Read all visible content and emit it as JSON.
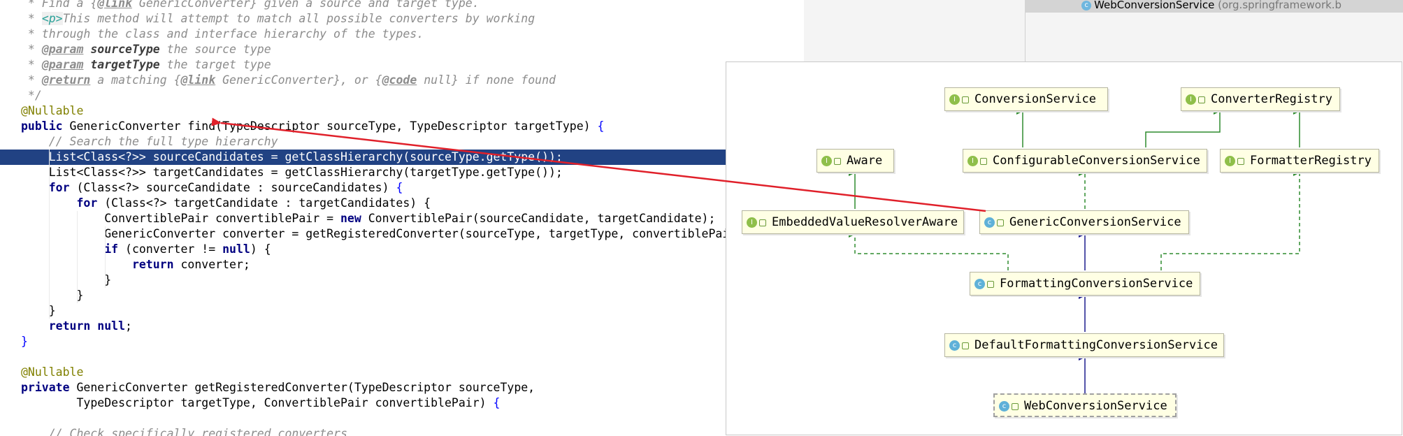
{
  "editor": {
    "lines": [
      [
        {
          "t": "cm",
          "v": " * Find a {"
        },
        {
          "t": "tag-b",
          "v": "@link"
        },
        {
          "t": "cm",
          "v": " GenericConverter} given a source and target type."
        }
      ],
      [
        {
          "t": "cm",
          "v": " * "
        },
        {
          "t": "tag-h",
          "v": "<p>"
        },
        {
          "t": "cm",
          "v": "This method will attempt to match all possible converters by working"
        }
      ],
      [
        {
          "t": "cm",
          "v": " * through the class and interface hierarchy of the types."
        }
      ],
      [
        {
          "t": "cm",
          "v": " * "
        },
        {
          "t": "tag-b",
          "v": "@param"
        },
        {
          "t": "cm",
          "v": " "
        },
        {
          "t": "pm",
          "v": "sourceType"
        },
        {
          "t": "cm",
          "v": " the source type"
        }
      ],
      [
        {
          "t": "cm",
          "v": " * "
        },
        {
          "t": "tag-b",
          "v": "@param"
        },
        {
          "t": "cm",
          "v": " "
        },
        {
          "t": "pm",
          "v": "targetType"
        },
        {
          "t": "cm",
          "v": " the target type"
        }
      ],
      [
        {
          "t": "cm",
          "v": " * "
        },
        {
          "t": "tag-b",
          "v": "@return"
        },
        {
          "t": "cm",
          "v": " a matching {"
        },
        {
          "t": "tag-b",
          "v": "@link"
        },
        {
          "t": "cm",
          "v": " GenericConverter}, or {"
        },
        {
          "t": "tag-b",
          "v": "@code"
        },
        {
          "t": "cm",
          "v": " null} if none found"
        }
      ],
      [
        {
          "t": "cm",
          "v": " */"
        }
      ],
      [
        {
          "t": "an",
          "v": "@Nullable"
        }
      ],
      [
        {
          "t": "kw",
          "v": "public"
        },
        {
          "t": "",
          "v": " GenericConverter find(TypeDescriptor sourceType, TypeDescriptor targetType) "
        },
        {
          "t": "br",
          "v": "{"
        }
      ],
      [
        {
          "t": "cm",
          "v": "    // Search the full type hierarchy"
        }
      ],
      [
        {
          "t": "",
          "v": "    List<Class<?>> sourceCandidates = getClassHierarchy(sourceType.getType());"
        }
      ],
      [
        {
          "t": "",
          "v": "    List<Class<?>> targetCandidates = getClassHierarchy(targetType.getType());"
        }
      ],
      [
        {
          "t": "kw",
          "v": "    for"
        },
        {
          "t": "",
          "v": " (Class<?> sourceCandidate : sourceCandidates) "
        },
        {
          "t": "br",
          "v": "{"
        }
      ],
      [
        {
          "t": "kw",
          "v": "        for"
        },
        {
          "t": "",
          "v": " (Class<?> targetCandidate : targetCandidates) {"
        }
      ],
      [
        {
          "t": "",
          "v": "            ConvertiblePair convertiblePair = "
        },
        {
          "t": "kw",
          "v": "new"
        },
        {
          "t": "",
          "v": " ConvertiblePair(sourceCandidate, targetCandidate);"
        }
      ],
      [
        {
          "t": "",
          "v": "            GenericConverter converter = getRegisteredConverter(sourceType, targetType, convertiblePair);"
        }
      ],
      [
        {
          "t": "kw",
          "v": "            if"
        },
        {
          "t": "",
          "v": " (converter != "
        },
        {
          "t": "kw",
          "v": "null"
        },
        {
          "t": "",
          "v": ") {"
        }
      ],
      [
        {
          "t": "kw",
          "v": "                return"
        },
        {
          "t": "",
          "v": " converter;"
        }
      ],
      [
        {
          "t": "",
          "v": "            }"
        }
      ],
      [
        {
          "t": "",
          "v": "        }"
        }
      ],
      [
        {
          "t": "",
          "v": "    }"
        }
      ],
      [
        {
          "t": "kw",
          "v": "    return null"
        },
        {
          "t": "",
          "v": ";"
        }
      ],
      [
        {
          "t": "br",
          "v": "}"
        }
      ],
      [
        {
          "t": "",
          "v": ""
        }
      ],
      [
        {
          "t": "an",
          "v": "@Nullable"
        }
      ],
      [
        {
          "t": "kw",
          "v": "private"
        },
        {
          "t": "",
          "v": " GenericConverter getRegisteredConverter(TypeDescriptor sourceType,"
        }
      ],
      [
        {
          "t": "",
          "v": "        TypeDescriptor targetType, ConvertiblePair convertiblePair) "
        },
        {
          "t": "br",
          "v": "{"
        }
      ],
      [
        {
          "t": "",
          "v": ""
        }
      ],
      [
        {
          "t": "cm",
          "v": "    // Check specifically registered converters"
        }
      ]
    ],
    "selected_line": 10
  },
  "structure": {
    "item_name": "WebConversionService",
    "item_package": "(org.springframework.b"
  },
  "diagram": {
    "nodes": [
      {
        "id": "conversion-service",
        "kind": "I",
        "label": "ConversionService"
      },
      {
        "id": "converter-registry",
        "kind": "I",
        "label": "ConverterRegistry"
      },
      {
        "id": "aware",
        "kind": "I",
        "label": "Aware"
      },
      {
        "id": "configurable-conversion-service",
        "kind": "I",
        "label": "ConfigurableConversionService"
      },
      {
        "id": "formatter-registry",
        "kind": "I",
        "label": "FormatterRegistry"
      },
      {
        "id": "embedded-value-resolver-aware",
        "kind": "I",
        "label": "EmbeddedValueResolverAware"
      },
      {
        "id": "generic-conversion-service",
        "kind": "C",
        "label": "GenericConversionService"
      },
      {
        "id": "formatting-conversion-service",
        "kind": "C",
        "label": "FormattingConversionService"
      },
      {
        "id": "default-formatting-conversion-service",
        "kind": "C",
        "label": "DefaultFormattingConversionService"
      },
      {
        "id": "web-conversion-service",
        "kind": "C",
        "label": "WebConversionService"
      }
    ]
  }
}
